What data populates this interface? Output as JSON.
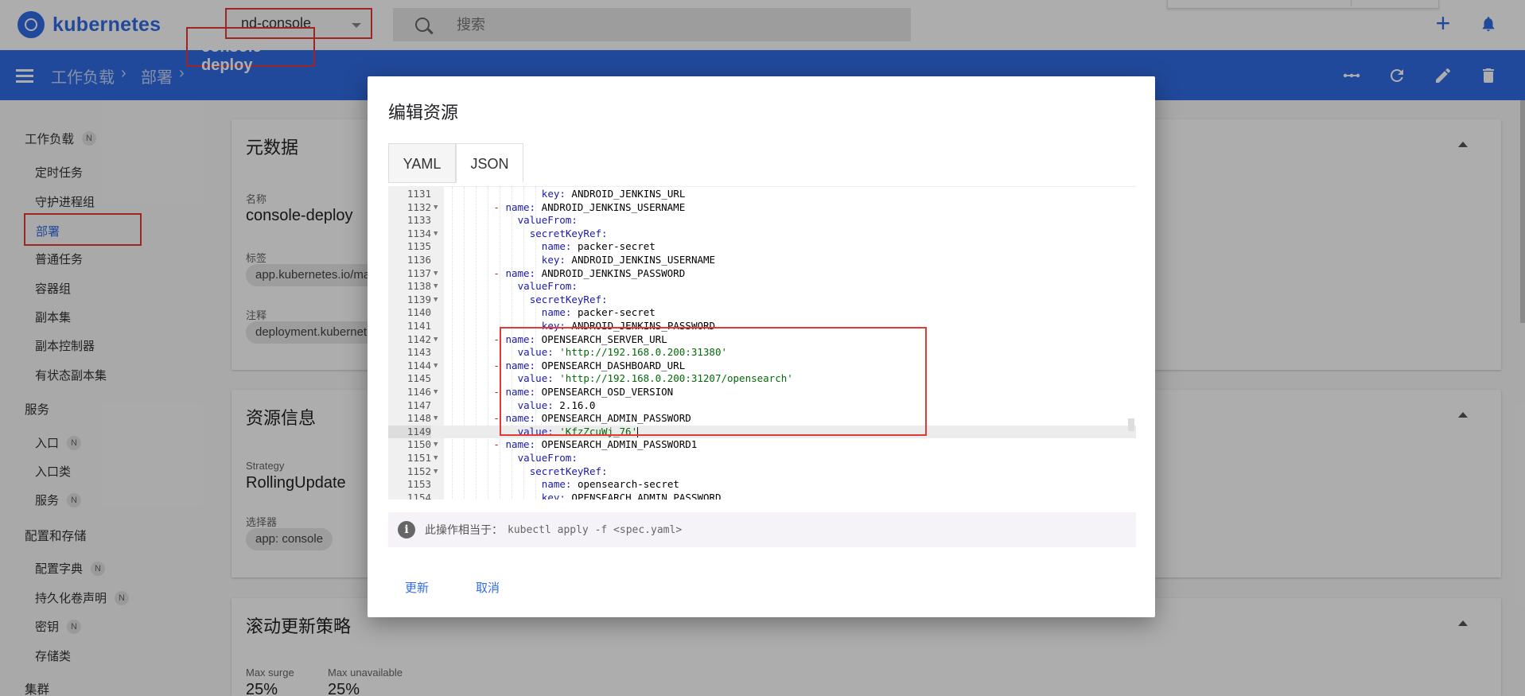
{
  "app": {
    "logo_text": "kubernetes",
    "accent": "#326ce5",
    "highlight_color": "#e53935"
  },
  "topbar": {
    "namespace": "nd-console",
    "search_placeholder": "搜索",
    "icons": [
      "search-icon",
      "add-icon",
      "bell-icon"
    ]
  },
  "header": {
    "breadcrumb": [
      "工作负载",
      "部署",
      "console-deploy"
    ],
    "actions": [
      "scale-icon",
      "restart-icon",
      "edit-icon",
      "delete-icon"
    ]
  },
  "sidebar": {
    "workloads": {
      "label": "工作负载",
      "badge": "N"
    },
    "workload_items": [
      "定时任务",
      "守护进程组",
      "部署",
      "普通任务",
      "容器组",
      "副本集",
      "副本控制器",
      "有状态副本集"
    ],
    "services": {
      "label": "服务"
    },
    "service_items": [
      {
        "label": "入口",
        "badge": "N"
      },
      {
        "label": "入口类",
        "badge": ""
      },
      {
        "label": "服务",
        "badge": "N"
      }
    ],
    "config": {
      "label": "配置和存储"
    },
    "config_items": [
      {
        "label": "配置字典",
        "badge": "N"
      },
      {
        "label": "持久化卷声明",
        "badge": "N"
      },
      {
        "label": "密钥",
        "badge": "N"
      },
      {
        "label": "存储类",
        "badge": ""
      }
    ],
    "cluster": {
      "label": "集群"
    }
  },
  "cards": {
    "metadata": {
      "title": "元数据",
      "name_label": "名称",
      "name_value": "console-deploy",
      "labels_label": "标签",
      "label_chip": "app.kubernetes.io/ma",
      "annotations_label": "注释",
      "annotation_chip": "deployment.kubernete"
    },
    "resource": {
      "title": "资源信息",
      "strategy_label": "Strategy",
      "strategy_value": "RollingUpdate",
      "selector_label": "选择器",
      "selector_chip": "app: console"
    },
    "rolling": {
      "title": "滚动更新策略",
      "max_surge_label": "Max surge",
      "max_surge_value": "25%",
      "max_unavailable_label": "Max unavailable",
      "max_unavailable_value": "25%"
    }
  },
  "modal": {
    "title": "编辑资源",
    "tabs": [
      "YAML",
      "JSON"
    ],
    "active_tab": "JSON",
    "info_text": "此操作相当于：",
    "info_command": "kubectl apply -f <spec.yaml>",
    "buttons": {
      "update": "更新",
      "cancel": "取消"
    },
    "lines": [
      {
        "n": "1131",
        "fold": false,
        "indent": 8,
        "dash": false,
        "key": "key:",
        "val": " ANDROID_JENKINS_URL",
        "str": false
      },
      {
        "n": "1132",
        "fold": true,
        "indent": 5,
        "dash": true,
        "key": "name:",
        "val": " ANDROID_JENKINS_USERNAME",
        "str": false
      },
      {
        "n": "1133",
        "fold": false,
        "indent": 6,
        "dash": false,
        "key": "valueFrom:",
        "val": "",
        "str": false
      },
      {
        "n": "1134",
        "fold": true,
        "indent": 7,
        "dash": false,
        "key": "secretKeyRef:",
        "val": "",
        "str": false
      },
      {
        "n": "1135",
        "fold": false,
        "indent": 8,
        "dash": false,
        "key": "name:",
        "val": " packer-secret",
        "str": false
      },
      {
        "n": "1136",
        "fold": false,
        "indent": 8,
        "dash": false,
        "key": "key:",
        "val": " ANDROID_JENKINS_USERNAME",
        "str": false
      },
      {
        "n": "1137",
        "fold": true,
        "indent": 5,
        "dash": true,
        "key": "name:",
        "val": " ANDROID_JENKINS_PASSWORD",
        "str": false
      },
      {
        "n": "1138",
        "fold": true,
        "indent": 6,
        "dash": false,
        "key": "valueFrom:",
        "val": "",
        "str": false
      },
      {
        "n": "1139",
        "fold": true,
        "indent": 7,
        "dash": false,
        "key": "secretKeyRef:",
        "val": "",
        "str": false
      },
      {
        "n": "1140",
        "fold": false,
        "indent": 8,
        "dash": false,
        "key": "name:",
        "val": " packer-secret",
        "str": false
      },
      {
        "n": "1141",
        "fold": false,
        "indent": 8,
        "dash": false,
        "key": "key:",
        "val": " ANDROID_JENKINS_PASSWORD",
        "str": false
      },
      {
        "n": "1142",
        "fold": true,
        "indent": 5,
        "dash": true,
        "key": "name:",
        "val": " OPENSEARCH_SERVER_URL",
        "str": false
      },
      {
        "n": "1143",
        "fold": false,
        "indent": 6,
        "dash": false,
        "key": "value:",
        "val": " 'http://192.168.0.200:31380'",
        "str": true
      },
      {
        "n": "1144",
        "fold": true,
        "indent": 5,
        "dash": true,
        "key": "name:",
        "val": " OPENSEARCH_DASHBOARD_URL",
        "str": false
      },
      {
        "n": "1145",
        "fold": false,
        "indent": 6,
        "dash": false,
        "key": "value:",
        "val": " 'http://192.168.0.200:31207/opensearch'",
        "str": true
      },
      {
        "n": "1146",
        "fold": true,
        "indent": 5,
        "dash": true,
        "key": "name:",
        "val": " OPENSEARCH_OSD_VERSION",
        "str": false
      },
      {
        "n": "1147",
        "fold": false,
        "indent": 6,
        "dash": false,
        "key": "value:",
        "val": " 2.16.0",
        "str": false
      },
      {
        "n": "1148",
        "fold": true,
        "indent": 5,
        "dash": true,
        "key": "name:",
        "val": " OPENSEARCH_ADMIN_PASSWORD",
        "str": false
      },
      {
        "n": "1149",
        "fold": false,
        "indent": 6,
        "dash": false,
        "key": "value:",
        "val": " 'KfzZcuWj_76'",
        "str": true,
        "active": true
      },
      {
        "n": "1150",
        "fold": true,
        "indent": 5,
        "dash": true,
        "key": "name:",
        "val": " OPENSEARCH_ADMIN_PASSWORD1",
        "str": false
      },
      {
        "n": "1151",
        "fold": true,
        "indent": 6,
        "dash": false,
        "key": "valueFrom:",
        "val": "",
        "str": false
      },
      {
        "n": "1152",
        "fold": true,
        "indent": 7,
        "dash": false,
        "key": "secretKeyRef:",
        "val": "",
        "str": false
      },
      {
        "n": "1153",
        "fold": false,
        "indent": 8,
        "dash": false,
        "key": "name:",
        "val": " opensearch-secret",
        "str": false
      },
      {
        "n": "1154",
        "fold": false,
        "indent": 8,
        "dash": false,
        "key": "key:",
        "val": " OPENSEARCH_ADMIN_PASSWORD",
        "str": false
      }
    ]
  }
}
